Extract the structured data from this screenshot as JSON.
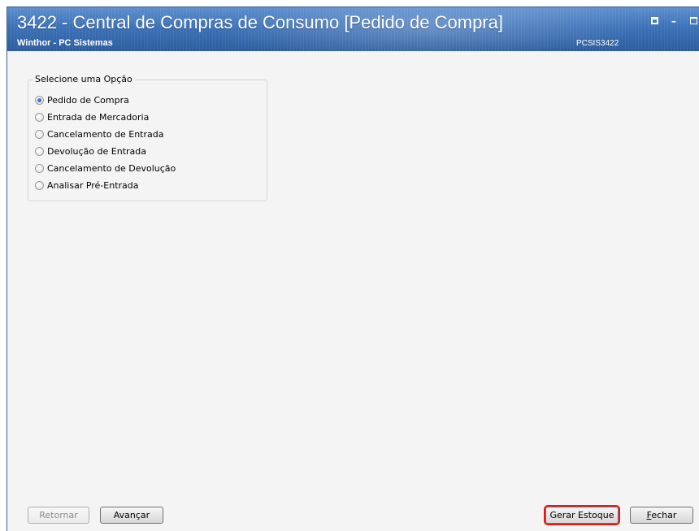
{
  "window": {
    "title": "3422 - Central de Compras de Consumo [Pedido de Compra]",
    "subtitle": "Winthor - PC Sistemas",
    "code": "PCSIS3422"
  },
  "group": {
    "legend": "Selecione uma Opção",
    "options": [
      {
        "label": "Pedido de Compra",
        "selected": true
      },
      {
        "label": "Entrada de Mercadoria",
        "selected": false
      },
      {
        "label": "Cancelamento de Entrada",
        "selected": false
      },
      {
        "label": "Devolução de Entrada",
        "selected": false
      },
      {
        "label": "Cancelamento de Devolução",
        "selected": false
      },
      {
        "label": "Analisar Pré-Entrada",
        "selected": false
      }
    ]
  },
  "footer": {
    "retornar": "Retornar",
    "avancar": "Avançar",
    "gerar_estoque": "Gerar Estoque",
    "fechar_first": "F",
    "fechar_rest": "echar"
  },
  "colors": {
    "titlebar": "#3d72b8",
    "highlight": "#e01b1b"
  }
}
